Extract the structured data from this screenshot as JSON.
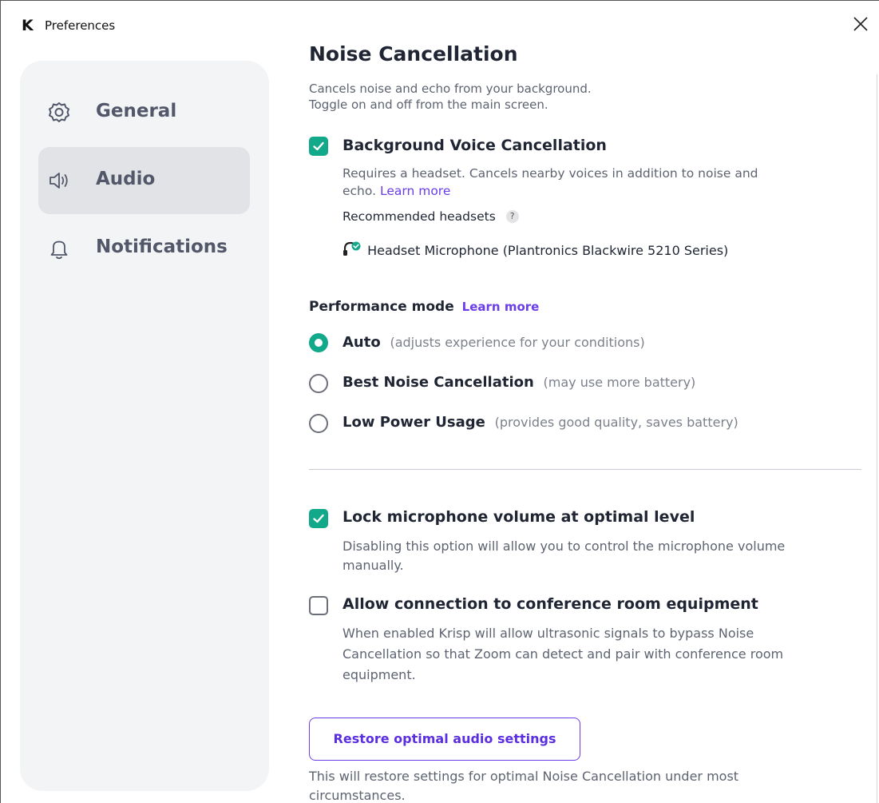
{
  "window": {
    "app_logo": "K",
    "title": "Preferences",
    "close_icon": "close-icon"
  },
  "sidebar": {
    "items": [
      {
        "label": "General",
        "icon": "gear-icon",
        "active": false
      },
      {
        "label": "Audio",
        "icon": "speaker-icon",
        "active": true
      },
      {
        "label": "Notifications",
        "icon": "bell-icon",
        "active": false
      }
    ]
  },
  "noise": {
    "heading": "Noise Cancellation",
    "desc_line1": "Cancels noise and echo from your background.",
    "desc_line2": "Toggle on and off from the main screen.",
    "bvc": {
      "title": "Background Voice Cancellation",
      "checked": true,
      "desc_line1": "Requires a headset. Cancels nearby voices in addition to noise and",
      "desc_line2_prefix": "echo.",
      "learn_more": "Learn more",
      "recommended_label": "Recommended headsets",
      "help": "?",
      "headset": "Headset Microphone (Plantronics Blackwire 5210 Series)"
    }
  },
  "performance": {
    "title": "Performance mode",
    "learn_more": "Learn more",
    "options": [
      {
        "label": "Auto",
        "hint": "(adjusts experience for your conditions)",
        "selected": true
      },
      {
        "label": "Best Noise Cancellation",
        "hint": "(may use more battery)",
        "selected": false
      },
      {
        "label": "Low Power Usage",
        "hint": "(provides good quality, saves battery)",
        "selected": false
      }
    ]
  },
  "lock_mic": {
    "title": "Lock microphone volume at optimal level",
    "checked": true,
    "desc_line1": "Disabling this option will allow you to control the microphone volume",
    "desc_line2": "manually."
  },
  "conference": {
    "title": "Allow connection to conference room equipment",
    "checked": false,
    "desc_line1": "When enabled Krisp will allow ultrasonic signals to bypass Noise",
    "desc_line2": "Cancellation so that Zoom can detect and pair with conference room",
    "desc_line3": "equipment."
  },
  "restore": {
    "button_label": "Restore optimal audio settings",
    "desc_line1": "This will restore settings for optimal Noise Cancellation under most",
    "desc_line2": "circumstances."
  },
  "colors": {
    "accent_green": "#12a88a",
    "link_purple": "#6a3de8",
    "sidebar_bg": "#f3f4f6",
    "sidebar_active": "#e2e3e6"
  }
}
